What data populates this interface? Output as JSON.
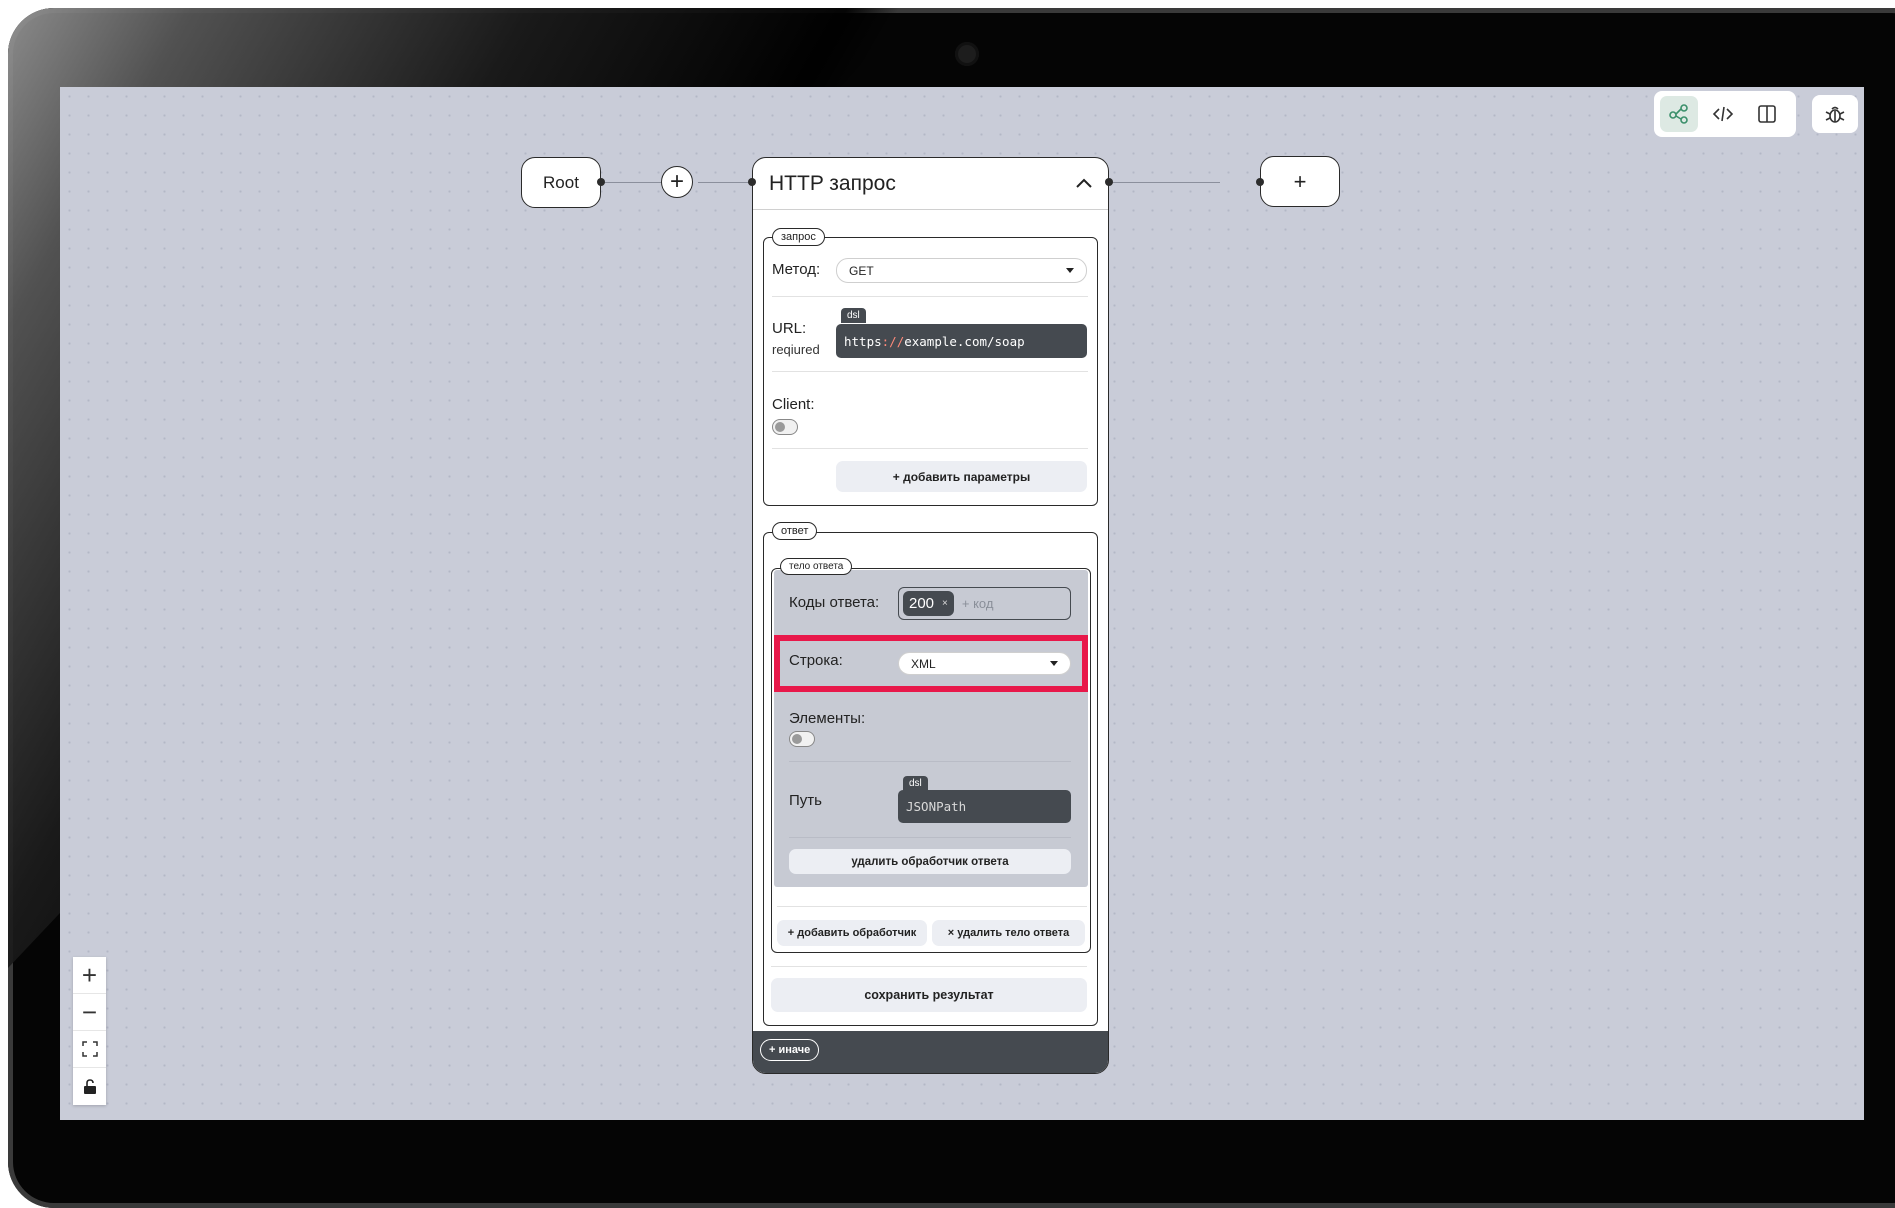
{
  "toolbar": {
    "buttons": [
      {
        "icon": "flow-graph-icon",
        "active": true
      },
      {
        "icon": "code-icon",
        "active": false
      },
      {
        "icon": "split-view-icon",
        "active": false
      }
    ],
    "debug_icon": "bug-icon"
  },
  "nodes": {
    "root_label": "Root",
    "add_between": "+",
    "add_after": "+"
  },
  "http_node": {
    "title": "HTTP запрос",
    "request": {
      "legend": "запрос",
      "method_label": "Метод:",
      "method_value": "GET",
      "url_label": "URL:",
      "url_required": "reqiured",
      "url_dsl": "dsl",
      "url_scheme": "https",
      "url_sep": "://",
      "url_rest": "example.com/soap",
      "client_label": "Client:",
      "add_params": "+ добавить параметры"
    },
    "response": {
      "legend": "ответ",
      "body_legend": "тело ответа",
      "codes_label": "Коды ответа:",
      "code_tag": "200",
      "code_tag_remove": "×",
      "code_placeholder": "+ код",
      "string_label": "Строка:",
      "string_value": "XML",
      "elements_label": "Элементы:",
      "path_label": "Путь",
      "path_dsl": "dsl",
      "path_placeholder": "JSONPath",
      "delete_handler": "удалить обработчик ответа",
      "add_handler": "+ добавить обработчик",
      "delete_body": "× удалить тело ответа"
    },
    "save_result": "сохранить результат",
    "else_button": "+ иначе"
  },
  "zoom": {
    "zoom_in": "+",
    "zoom_out": "−"
  },
  "colors": {
    "canvas": "#c9ccd8",
    "highlight": "#e8184a",
    "dark": "#454a50",
    "active_toolbar": "#dde9e3"
  }
}
